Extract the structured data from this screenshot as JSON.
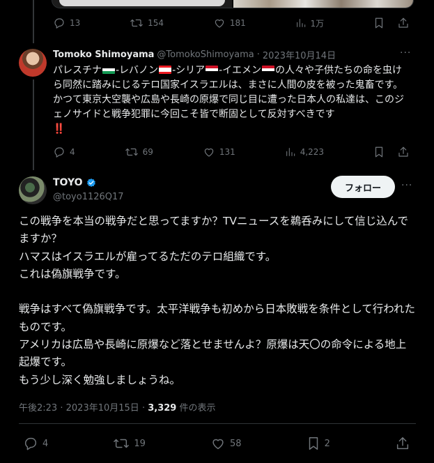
{
  "prev_tweet": {
    "replies": "13",
    "retweets": "154",
    "likes": "181",
    "views": "1万"
  },
  "reply_tweet": {
    "name": "Tomoko Shimoyama",
    "handle": "@TomokoShimoyama",
    "sep": "·",
    "date": "2023年10月14日",
    "text_1": "パレスチナ",
    "text_2": "-レバノン",
    "text_3": "-シリア",
    "text_4": "-イエメン",
    "text_5": "の人々や子供たちの命を虫けら同然に踏みにじるテロ国家イスラエルは、まさに人間の皮を被った鬼畜です。かつて東京大空襲や広島や長崎の原爆で同じ目に遭った日本人の私達は、このジェノサイドと戦争犯罪に今回こそ皆で断固として反対すべきです",
    "emphasis": "‼️",
    "replies": "4",
    "retweets": "69",
    "likes": "131",
    "views": "4,223"
  },
  "main_tweet": {
    "name": "TOYO",
    "handle": "@toyo1126Q17",
    "follow_label": "フォロー",
    "text": "この戦争を本当の戦争だと思ってますか？TVニュースを鵜呑みにして信じ込んでますか？\nハマスはイスラエルが雇ってるただのテロ組織です。\nこれは偽旗戦争です。\n\n戦争はすべて偽旗戦争です。太平洋戦争も初めから日本敗戦を条件として行われたものです。\nアメリカは広島や長崎に原爆など落とせませんよ？原爆は天〇の命令による地上起爆です。\nもう少し深く勉強しましょうね。",
    "time": "午後2:23",
    "dot": "·",
    "date": "2023年10月15日",
    "views_count": "3,329",
    "views_label": "件の表示",
    "replies": "4",
    "retweets": "19",
    "likes": "58",
    "bookmarks": "2"
  },
  "colors": {
    "background": "#000000",
    "text": "#e7e9ea",
    "muted": "#71767b",
    "border": "#2f3336",
    "verified": "#1d9bf0"
  }
}
